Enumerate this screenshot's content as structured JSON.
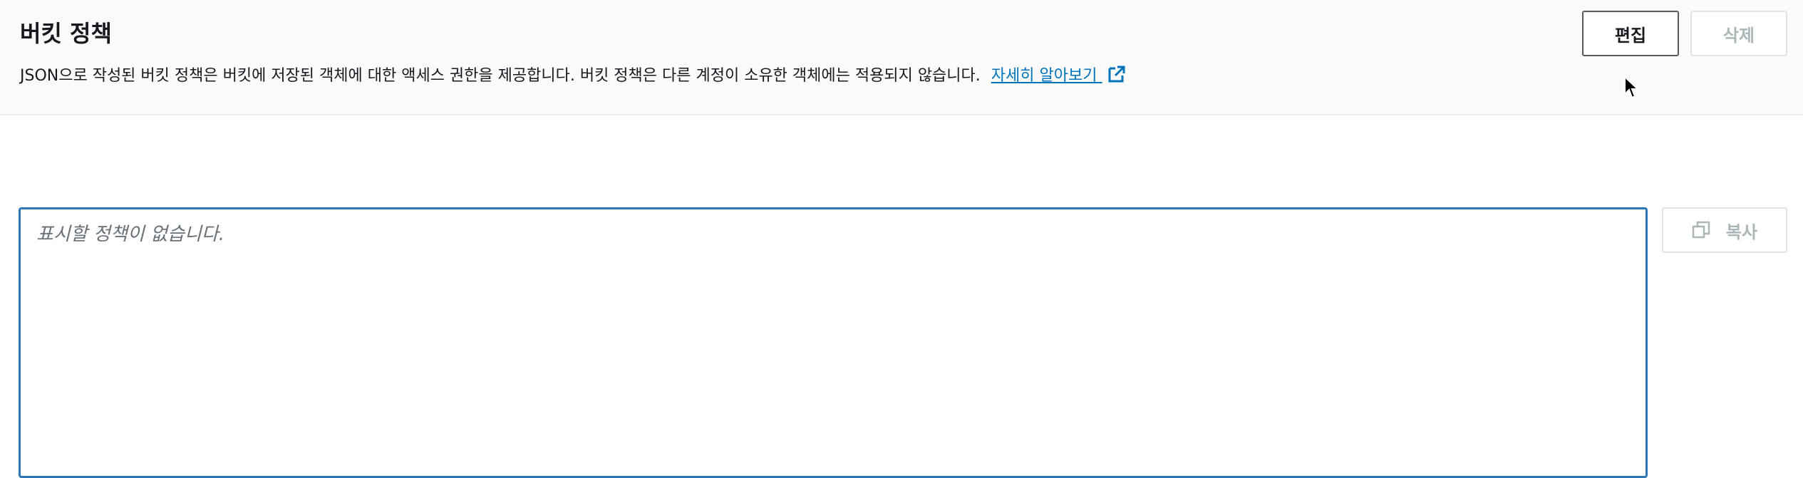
{
  "header": {
    "title": "버킷 정책",
    "description": "JSON으로 작성된 버킷 정책은 버킷에 저장된 객체에 대한 액세스 권한을 제공합니다. 버킷 정책은 다른 계정이 소유한 객체에는 적용되지 않습니다.",
    "learn_more": "자세히 알아보기",
    "learn_more_icon": "external-link-icon",
    "edit_label": "편집",
    "delete_label": "삭제"
  },
  "policy": {
    "placeholder": "표시할 정책이 없습니다.",
    "copy_label": "복사",
    "copy_icon": "copy-icon"
  },
  "colors": {
    "link": "#0073bb",
    "focus_border": "#2e75b6",
    "header_bg": "#fafafa",
    "disabled_text": "#aab7b8"
  }
}
